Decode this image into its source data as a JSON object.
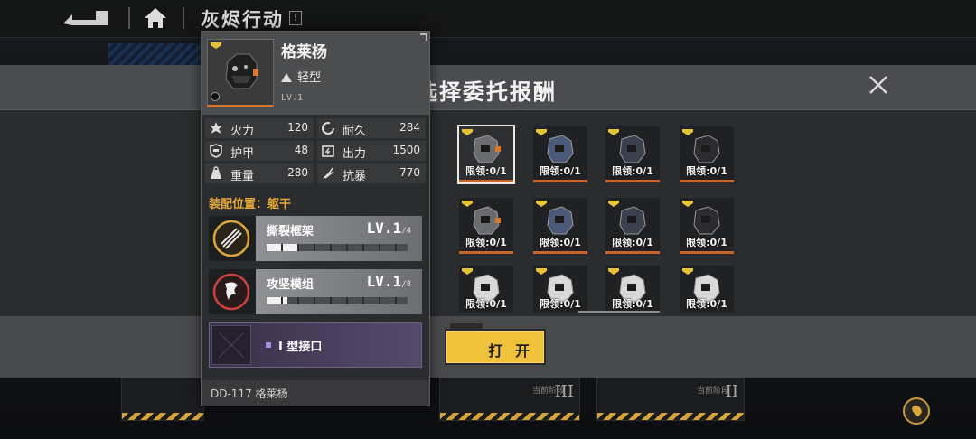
{
  "header": {
    "title": "灰烬行动",
    "info_mark": "!"
  },
  "modal": {
    "title": "选择委托报酬",
    "open_button": "打 开",
    "items": [
      {
        "limit": "限领:0/1",
        "selected": true
      },
      {
        "limit": "限领:0/1"
      },
      {
        "limit": "限领:0/1"
      },
      {
        "limit": "限领:0/1"
      },
      {
        "limit": "限领:0/1"
      },
      {
        "limit": "限领:0/1"
      },
      {
        "limit": "限领:0/1"
      },
      {
        "limit": "限领:0/1"
      },
      {
        "limit": "限领:0/1"
      },
      {
        "limit": "限领:0/1"
      },
      {
        "limit": "限领:0/1"
      },
      {
        "limit": "限领:0/1"
      }
    ]
  },
  "background": {
    "stage_label": "当前阶段",
    "stage_numerals": [
      "III",
      "II"
    ]
  },
  "detail": {
    "name": "格莱杨",
    "weight_class": "轻型",
    "level": "LV.1",
    "stats": {
      "firepower": {
        "label": "火力",
        "value": "120"
      },
      "durability": {
        "label": "耐久",
        "value": "284"
      },
      "armor": {
        "label": "护甲",
        "value": "48"
      },
      "output": {
        "label": "出力",
        "value": "1500"
      },
      "weight": {
        "label": "重量",
        "value": "280"
      },
      "crit_resist": {
        "label": "抗暴",
        "value": "770"
      }
    },
    "slot_position": "装配位置：躯干",
    "modules": [
      {
        "name": "撕裂框架",
        "level": "LV.1",
        "max": "/4",
        "progress": 0.22
      },
      {
        "name": "攻坚模组",
        "level": "LV.1",
        "max": "/8",
        "progress": 0.15
      }
    ],
    "interface_label": "I 型接口",
    "footer_code": "DD-117 格莱杨"
  },
  "colors": {
    "accent_yellow": "#f0c13a",
    "accent_orange": "#c8642a",
    "slot_title": "#e8a838",
    "interface_purple": "#a98fe0"
  }
}
